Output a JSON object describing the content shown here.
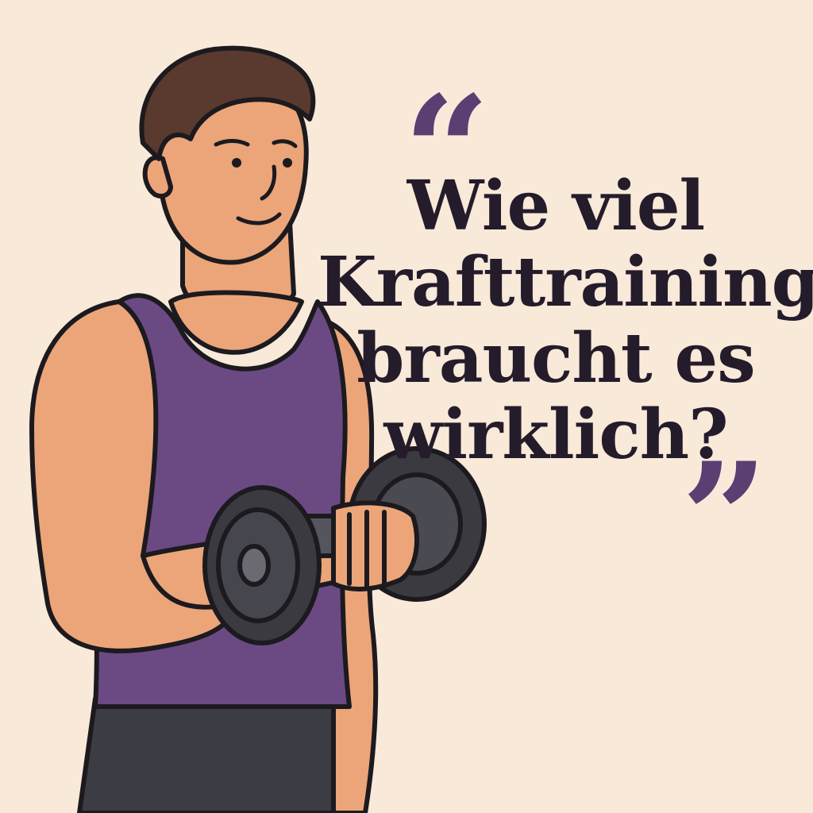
{
  "quote": {
    "open_mark": "“",
    "close_mark": "”",
    "lines": [
      "Wie viel",
      "Krafttraining",
      "braucht es",
      "wirklich?"
    ]
  },
  "colors": {
    "background": "#f8e9d9",
    "accent": "#5b3f72",
    "text": "#241c2b",
    "skin": "#eba579",
    "hair": "#5a3a2e",
    "tank_top": "#6b4a83",
    "dumbbell": "#3a3a40"
  },
  "illustration": {
    "subject": "man-curling-dumbbell"
  }
}
